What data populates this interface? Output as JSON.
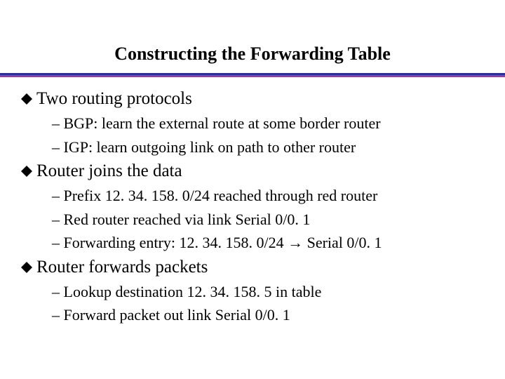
{
  "title": "Constructing the Forwarding Table",
  "sections": [
    {
      "heading": "Two routing protocols",
      "subs": [
        "– BGP: learn the external route at some border router",
        "– IGP: learn outgoing link on path to other router"
      ]
    },
    {
      "heading": "Router joins the data",
      "subs": [
        "– Prefix 12. 34. 158. 0/24 reached through red router",
        "– Red router reached via link Serial 0/0. 1",
        "– Forwarding entry: 12. 34. 158. 0/24 → Serial 0/0. 1"
      ]
    },
    {
      "heading": "Router forwards packets",
      "subs": [
        "– Lookup destination 12. 34. 158. 5 in table",
        "– Forward packet out link Serial 0/0. 1"
      ]
    }
  ]
}
